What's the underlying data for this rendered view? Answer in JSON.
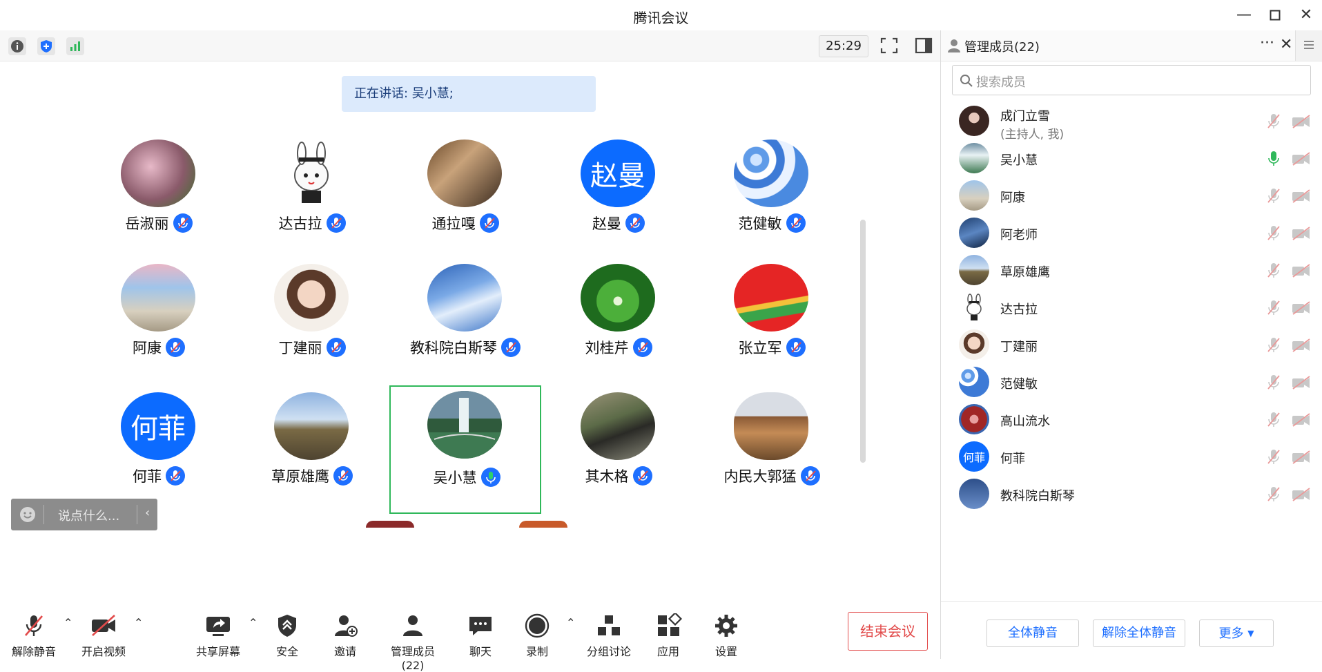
{
  "window": {
    "title": "腾讯会议"
  },
  "topbar": {
    "timer": "25:29"
  },
  "speaking": {
    "text": "正在讲话: 吴小慧;"
  },
  "tiles": [
    {
      "name": "岳淑丽",
      "avatar": "photo-blossoms"
    },
    {
      "name": "达古拉",
      "avatar": "photo-cartoon-rabbit"
    },
    {
      "name": "通拉嘎",
      "avatar": "photo-children"
    },
    {
      "name": "赵曼",
      "avatar": "letters",
      "letters": "赵曼"
    },
    {
      "name": "范健敏",
      "avatar": "photo-blue-beads"
    },
    {
      "name": "阿康",
      "avatar": "photo-person-banner"
    },
    {
      "name": "丁建丽",
      "avatar": "photo-woman-portrait"
    },
    {
      "name": "教科院白斯琴",
      "avatar": "photo-sky-clouds"
    },
    {
      "name": "刘桂芹",
      "avatar": "photo-green-tunnel"
    },
    {
      "name": "张立军",
      "avatar": "photo-red-logo"
    },
    {
      "name": "何菲",
      "avatar": "letters",
      "letters": "何菲"
    },
    {
      "name": "草原雄鹰",
      "avatar": "photo-grassland"
    },
    {
      "name": "吴小慧",
      "avatar": "photo-waterfall",
      "speaking": true
    },
    {
      "name": "其木格",
      "avatar": "photo-kids-pond"
    },
    {
      "name": "内民大郭猛",
      "avatar": "photo-monument"
    }
  ],
  "chat_input": {
    "placeholder": "说点什么..."
  },
  "toolbar": [
    {
      "label": "解除静音",
      "icon": "mic-muted-icon"
    },
    {
      "label": "开启视频",
      "icon": "video-off-icon"
    },
    {
      "label": "共享屏幕",
      "icon": "share-screen-icon"
    },
    {
      "label": "安全",
      "icon": "shield-icon"
    },
    {
      "label": "邀请",
      "icon": "invite-icon"
    },
    {
      "label": "管理成员(22)",
      "icon": "members-icon"
    },
    {
      "label": "聊天",
      "icon": "chat-icon"
    },
    {
      "label": "录制",
      "icon": "record-icon"
    },
    {
      "label": "分组讨论",
      "icon": "breakout-icon"
    },
    {
      "label": "应用",
      "icon": "apps-icon"
    },
    {
      "label": "设置",
      "icon": "gear-icon"
    }
  ],
  "end_meeting": "结束会议",
  "panel": {
    "title": "管理成员(22)",
    "search_placeholder": "搜索成员",
    "members": [
      {
        "name": "成门立雪",
        "sub": "(主持人, 我)",
        "mic": "muted"
      },
      {
        "name": "吴小慧",
        "mic": "on"
      },
      {
        "name": "阿康",
        "mic": "muted"
      },
      {
        "name": "阿老师",
        "mic": "muted"
      },
      {
        "name": "草原雄鹰",
        "mic": "muted"
      },
      {
        "name": "达古拉",
        "mic": "muted"
      },
      {
        "name": "丁建丽",
        "mic": "muted"
      },
      {
        "name": "范健敏",
        "mic": "muted"
      },
      {
        "name": "高山流水",
        "mic": "muted"
      },
      {
        "name": "何菲",
        "mic": "muted",
        "letters": "何菲"
      },
      {
        "name": "教科院白斯琴",
        "mic": "muted"
      }
    ],
    "footer": {
      "mute_all": "全体静音",
      "unmute_all": "解除全体静音",
      "more": "更多"
    }
  },
  "colors": {
    "accent": "#1e6fff",
    "speaking_border": "#2fb85a",
    "end": "#e24b4b",
    "banner_bg": "#dceafc"
  }
}
